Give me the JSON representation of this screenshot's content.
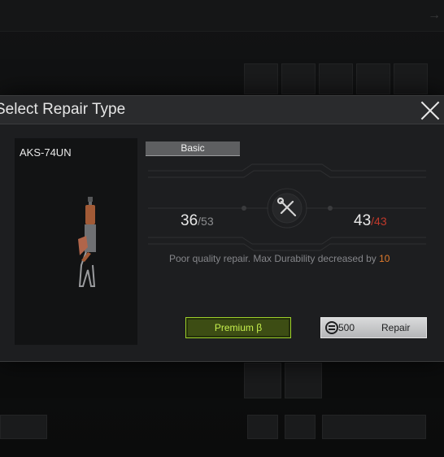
{
  "modal": {
    "title": "Select Repair Type",
    "item_name": "AKS-74UN",
    "tab_basic": "Basic",
    "durability_before": {
      "current": "36",
      "max": "/53"
    },
    "durability_after": {
      "current": "43",
      "max": "/43"
    },
    "note_prefix": "Poor quality repair. Max Durability decreased by ",
    "note_value": "10",
    "premium_label": "Premium β",
    "repair_cost": "500",
    "repair_label": "Repair"
  },
  "icons": {
    "close": "close-icon",
    "wrench": "wrench-screwdriver-icon",
    "currency": "koen-currency-icon",
    "weapon": "aks-74un-rifle"
  },
  "colors": {
    "premium_accent": "#9ed12a",
    "note_highlight": "#e07b2c",
    "max_durability_lost": "#c0392b"
  }
}
